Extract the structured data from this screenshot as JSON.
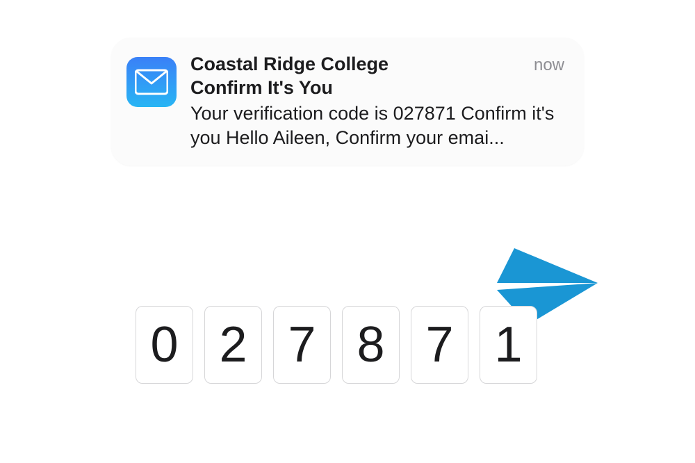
{
  "notification": {
    "sender": "Coastal Ridge College",
    "subject": "Confirm It's You",
    "body": "Your verification code is 027871 Confirm it's you Hello Aileen, Confirm your emai...",
    "timestamp": "now",
    "icon": "mail-icon"
  },
  "code_input": {
    "digits": [
      "0",
      "2",
      "7",
      "8",
      "7",
      "1"
    ]
  }
}
